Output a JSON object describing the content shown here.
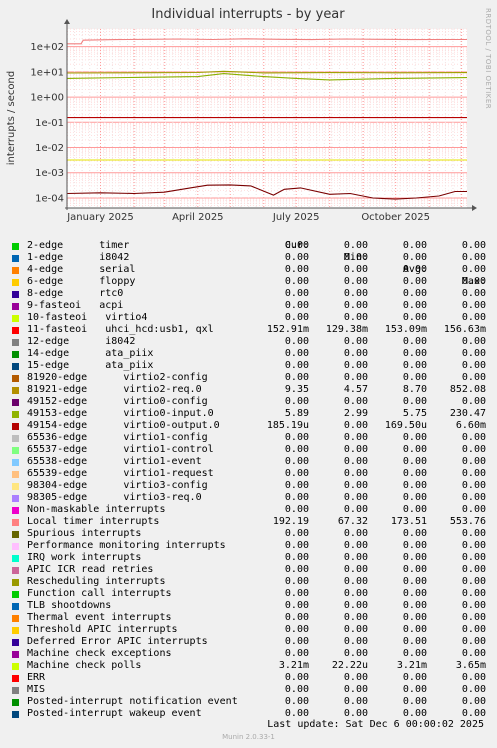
{
  "chart_data": {
    "type": "line",
    "title": "Individual interrupts - by year",
    "ylabel": "interrupts / second",
    "side_label": "RRDTOOL / TOBI OETIKER",
    "y_scale": "log",
    "ylim": [
      4e-05,
      500
    ],
    "y_ticks": [
      "1e+02",
      "1e+01",
      "1e+00",
      "1e-01",
      "1e-02",
      "1e-03",
      "1e-04"
    ],
    "x_ticks": [
      "January 2025",
      "April 2025",
      "July 2025",
      "October 2025"
    ],
    "x_range": [
      "2024-12-01",
      "2025-12-06"
    ],
    "grid": true,
    "series": [
      {
        "name": "Local timer interrupts",
        "color": "#f08080",
        "x": [
          "2024-12-01",
          "2024-12-14",
          "2024-12-16",
          "2025-01-15",
          "2025-02-15",
          "2025-03-15",
          "2025-04-15",
          "2025-05-15",
          "2025-06-15",
          "2025-07-15",
          "2025-08-15",
          "2025-09-15",
          "2025-10-15",
          "2025-11-15",
          "2025-12-06"
        ],
        "values": [
          130,
          130,
          180,
          190,
          195,
          200,
          192,
          205,
          195,
          190,
          200,
          195,
          190,
          192,
          192
        ]
      },
      {
        "name": "11-fasteoi uhci_hcd:usb1, qxl",
        "color": "#b80000",
        "x": [
          "2024-12-01",
          "2025-12-06"
        ],
        "values": [
          0.153,
          0.153
        ]
      },
      {
        "name": "49154-edge virtio0-output.0",
        "color": "#7a0000",
        "x": [
          "2024-12-01",
          "2025-01-01",
          "2025-02-01",
          "2025-03-01",
          "2025-03-25",
          "2025-04-10",
          "2025-05-01",
          "2025-05-20",
          "2025-06-10",
          "2025-06-20",
          "2025-07-05",
          "2025-08-01",
          "2025-08-20",
          "2025-09-10",
          "2025-10-01",
          "2025-10-20",
          "2025-11-10",
          "2025-11-25",
          "2025-12-06"
        ],
        "values": [
          0.00015,
          0.00016,
          0.00015,
          0.00017,
          0.00025,
          0.00032,
          0.00033,
          0.0003,
          0.00013,
          0.00022,
          0.00025,
          0.00014,
          0.00015,
          0.0001,
          9e-05,
          0.0001,
          0.00012,
          0.00018,
          0.00018
        ]
      },
      {
        "name": "81921-edge virtio2-req.0",
        "color": "#a0a000",
        "x": [
          "2024-12-01",
          "2025-02-01",
          "2025-04-01",
          "2025-04-25",
          "2025-06-01",
          "2025-08-01",
          "2025-10-01",
          "2025-12-06"
        ],
        "values": [
          9,
          9.2,
          9.4,
          10.5,
          9.1,
          9.3,
          9.2,
          9.3
        ]
      },
      {
        "name": "49153-edge virtio0-input.0",
        "color": "#8ab000",
        "x": [
          "2024-12-01",
          "2025-02-01",
          "2025-04-01",
          "2025-04-25",
          "2025-06-01",
          "2025-07-01",
          "2025-08-01",
          "2025-10-01",
          "2025-12-06"
        ],
        "values": [
          5.5,
          6,
          6.5,
          8.5,
          6.5,
          5.5,
          4.8,
          5.5,
          5.9
        ]
      },
      {
        "name": "Machine check polls",
        "color": "#e6e600",
        "x": [
          "2024-12-01",
          "2025-12-06"
        ],
        "values": [
          0.0032,
          0.0032
        ]
      }
    ]
  },
  "legend": {
    "headers": {
      "cur": "Cur:",
      "min": "Min:",
      "avg": "Avg:",
      "max": "Max:"
    },
    "rows": [
      {
        "label": "2-edge      timer",
        "color": "#00cc00",
        "cur": "0.00",
        "min": "0.00",
        "avg": "0.00",
        "max": "0.00"
      },
      {
        "label": "1-edge      i8042",
        "color": "#0066b3",
        "cur": "0.00",
        "min": "0.00",
        "avg": "0.00",
        "max": "0.00"
      },
      {
        "label": "4-edge      serial",
        "color": "#ff8000",
        "cur": "0.00",
        "min": "0.00",
        "avg": "0.00",
        "max": "0.00"
      },
      {
        "label": "6-edge      floppy",
        "color": "#ffcc00",
        "cur": "0.00",
        "min": "0.00",
        "avg": "0.00",
        "max": "0.00"
      },
      {
        "label": "8-edge      rtc0",
        "color": "#330099",
        "cur": "0.00",
        "min": "0.00",
        "avg": "0.00",
        "max": "0.00"
      },
      {
        "label": "9-fasteoi   acpi",
        "color": "#990099",
        "cur": "0.00",
        "min": "0.00",
        "avg": "0.00",
        "max": "0.00"
      },
      {
        "label": "10-fasteoi   virtio4",
        "color": "#ccff00",
        "cur": "0.00",
        "min": "0.00",
        "avg": "0.00",
        "max": "0.00"
      },
      {
        "label": "11-fasteoi   uhci_hcd:usb1, qxl",
        "color": "#ff0000",
        "cur": "152.91m",
        "min": "129.38m",
        "avg": "153.09m",
        "max": "156.63m"
      },
      {
        "label": "12-edge      i8042",
        "color": "#808080",
        "cur": "0.00",
        "min": "0.00",
        "avg": "0.00",
        "max": "0.00"
      },
      {
        "label": "14-edge      ata_piix",
        "color": "#008f00",
        "cur": "0.00",
        "min": "0.00",
        "avg": "0.00",
        "max": "0.00"
      },
      {
        "label": "15-edge      ata_piix",
        "color": "#00487d",
        "cur": "0.00",
        "min": "0.00",
        "avg": "0.00",
        "max": "0.00"
      },
      {
        "label": "81920-edge      virtio2-config",
        "color": "#b35a00",
        "cur": "0.00",
        "min": "0.00",
        "avg": "0.00",
        "max": "0.00"
      },
      {
        "label": "81921-edge      virtio2-req.0",
        "color": "#b38f00",
        "cur": "9.35",
        "min": "4.57",
        "avg": "8.70",
        "max": "852.08"
      },
      {
        "label": "49152-edge      virtio0-config",
        "color": "#6b006b",
        "cur": "0.00",
        "min": "0.00",
        "avg": "0.00",
        "max": "0.00"
      },
      {
        "label": "49153-edge      virtio0-input.0",
        "color": "#8fb300",
        "cur": "5.89",
        "min": "2.99",
        "avg": "5.75",
        "max": "230.47"
      },
      {
        "label": "49154-edge      virtio0-output.0",
        "color": "#b30000",
        "cur": "185.19u",
        "min": "0.00",
        "avg": "169.50u",
        "max": "6.60m"
      },
      {
        "label": "65536-edge      virtio1-config",
        "color": "#bebebe",
        "cur": "0.00",
        "min": "0.00",
        "avg": "0.00",
        "max": "0.00"
      },
      {
        "label": "65537-edge      virtio1-control",
        "color": "#80ff80",
        "cur": "0.00",
        "min": "0.00",
        "avg": "0.00",
        "max": "0.00"
      },
      {
        "label": "65538-edge      virtio1-event",
        "color": "#80c9ff",
        "cur": "0.00",
        "min": "0.00",
        "avg": "0.00",
        "max": "0.00"
      },
      {
        "label": "65539-edge      virtio1-request",
        "color": "#ffc080",
        "cur": "0.00",
        "min": "0.00",
        "avg": "0.00",
        "max": "0.00"
      },
      {
        "label": "98304-edge      virtio3-config",
        "color": "#ffe680",
        "cur": "0.00",
        "min": "0.00",
        "avg": "0.00",
        "max": "0.00"
      },
      {
        "label": "98305-edge      virtio3-req.0",
        "color": "#aa80ff",
        "cur": "0.00",
        "min": "0.00",
        "avg": "0.00",
        "max": "0.00"
      },
      {
        "label": "Non-maskable interrupts",
        "color": "#ee00cc",
        "cur": "0.00",
        "min": "0.00",
        "avg": "0.00",
        "max": "0.00"
      },
      {
        "label": "Local timer interrupts",
        "color": "#ff8080",
        "cur": "192.19",
        "min": "67.32",
        "avg": "173.51",
        "max": "553.76"
      },
      {
        "label": "Spurious interrupts",
        "color": "#666600",
        "cur": "0.00",
        "min": "0.00",
        "avg": "0.00",
        "max": "0.00"
      },
      {
        "label": "Performance monitoring interrupts",
        "color": "#ffbfff",
        "cur": "0.00",
        "min": "0.00",
        "avg": "0.00",
        "max": "0.00"
      },
      {
        "label": "IRQ work interrupts",
        "color": "#00ffcc",
        "cur": "0.00",
        "min": "0.00",
        "avg": "0.00",
        "max": "0.00"
      },
      {
        "label": "APIC ICR read retries",
        "color": "#cc6699",
        "cur": "0.00",
        "min": "0.00",
        "avg": "0.00",
        "max": "0.00"
      },
      {
        "label": "Rescheduling interrupts",
        "color": "#999900",
        "cur": "0.00",
        "min": "0.00",
        "avg": "0.00",
        "max": "0.00"
      },
      {
        "label": "Function call interrupts",
        "color": "#00cc00",
        "cur": "0.00",
        "min": "0.00",
        "avg": "0.00",
        "max": "0.00"
      },
      {
        "label": "TLB shootdowns",
        "color": "#0066b3",
        "cur": "0.00",
        "min": "0.00",
        "avg": "0.00",
        "max": "0.00"
      },
      {
        "label": "Thermal event interrupts",
        "color": "#ff8000",
        "cur": "0.00",
        "min": "0.00",
        "avg": "0.00",
        "max": "0.00"
      },
      {
        "label": "Threshold APIC interrupts",
        "color": "#ffcc00",
        "cur": "0.00",
        "min": "0.00",
        "avg": "0.00",
        "max": "0.00"
      },
      {
        "label": "Deferred Error APIC interrupts",
        "color": "#330099",
        "cur": "0.00",
        "min": "0.00",
        "avg": "0.00",
        "max": "0.00"
      },
      {
        "label": "Machine check exceptions",
        "color": "#990099",
        "cur": "0.00",
        "min": "0.00",
        "avg": "0.00",
        "max": "0.00"
      },
      {
        "label": "Machine check polls",
        "color": "#ccff00",
        "cur": "3.21m",
        "min": "22.22u",
        "avg": "3.21m",
        "max": "3.65m"
      },
      {
        "label": "ERR",
        "color": "#ff0000",
        "cur": "0.00",
        "min": "0.00",
        "avg": "0.00",
        "max": "0.00"
      },
      {
        "label": "MIS",
        "color": "#808080",
        "cur": "0.00",
        "min": "0.00",
        "avg": "0.00",
        "max": "0.00"
      },
      {
        "label": "Posted-interrupt notification event",
        "color": "#008f00",
        "cur": "0.00",
        "min": "0.00",
        "avg": "0.00",
        "max": "0.00"
      },
      {
        "label": "Posted-interrupt wakeup event",
        "color": "#00487d",
        "cur": "0.00",
        "min": "0.00",
        "avg": "0.00",
        "max": "0.00"
      }
    ]
  },
  "last_update": "Last update:  Sat Dec  6 00:00:02 2025",
  "munin_version": "Munin 2.0.33-1"
}
